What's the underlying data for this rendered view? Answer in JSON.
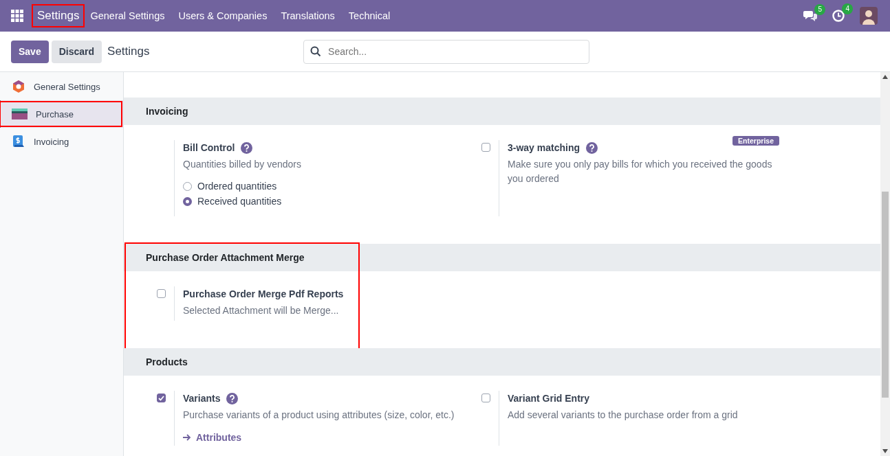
{
  "navbar": {
    "brand": {
      "label": "Settings",
      "highlighted": true
    },
    "menu": [
      "General Settings",
      "Users & Companies",
      "Translations",
      "Technical"
    ],
    "messages_count": "5",
    "activities_count": "4"
  },
  "control_bar": {
    "buttons": [
      {
        "label": "Save",
        "kind": "primary"
      },
      {
        "label": "Discard",
        "kind": "secondary"
      }
    ],
    "title": "Settings",
    "search": {
      "placeholder": "Search..."
    }
  },
  "sidebar": {
    "items": [
      {
        "label": "General Settings",
        "selected": false,
        "highlighted": false
      },
      {
        "label": "Purchase",
        "selected": true,
        "highlighted": true
      },
      {
        "label": "Invoicing",
        "selected": false,
        "highlighted": false
      }
    ]
  },
  "sections": [
    {
      "title": "Invoicing",
      "highlighted": false,
      "settings": [
        {
          "kind": "radio",
          "title": "Bill Control",
          "help": true,
          "description": "Quantities billed by vendors",
          "options": [
            {
              "label": "Ordered quantities",
              "selected": false
            },
            {
              "label": "Received quantities",
              "selected": true
            }
          ]
        },
        {
          "kind": "checkbox",
          "title": "3-way matching",
          "checked": false,
          "help": true,
          "badge": "Enterprise",
          "description": "Make sure you only pay bills for which you received the goods you ordered"
        }
      ]
    },
    {
      "title": "Purchase Order Attachment Merge",
      "highlighted": true,
      "settings": [
        {
          "kind": "checkbox",
          "title": "Purchase Order Merge Pdf Reports",
          "checked": false,
          "help": false,
          "description": "Selected Attachment will be Merge..."
        }
      ]
    },
    {
      "title": "Products",
      "highlighted": false,
      "settings": [
        {
          "kind": "checkbox",
          "title": "Variants",
          "checked": true,
          "help": true,
          "description": "Purchase variants of a product using attributes (size, color, etc.)",
          "link": "Attributes"
        },
        {
          "kind": "checkbox",
          "title": "Variant Grid Entry",
          "checked": false,
          "help": false,
          "description": "Add several variants to the purchase order from a grid"
        }
      ]
    }
  ]
}
